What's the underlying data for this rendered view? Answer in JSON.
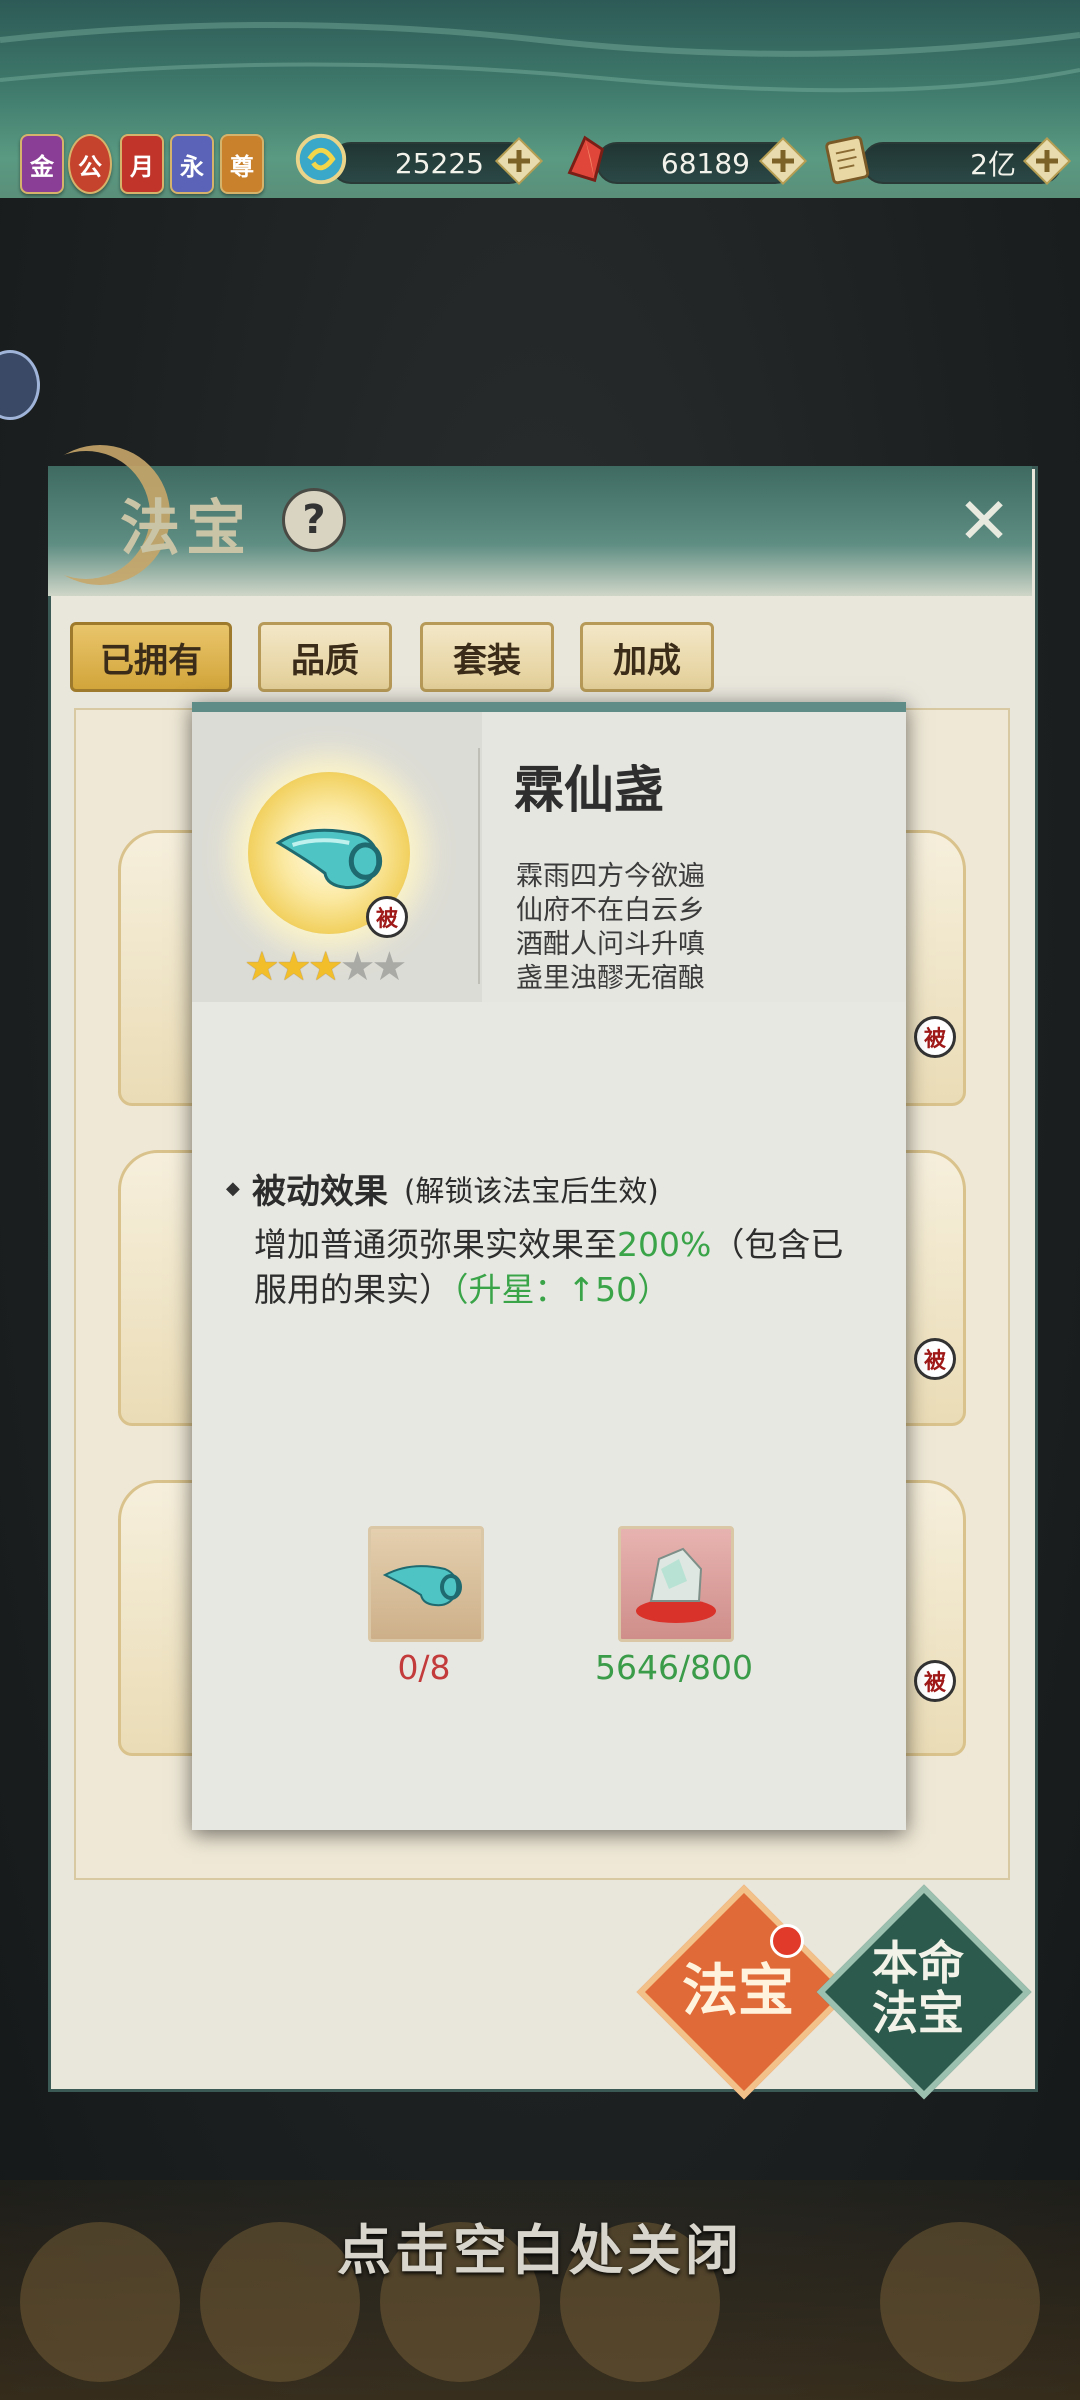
{
  "top_bar": {
    "badges": [
      "金",
      "公",
      "月",
      "永",
      "尊"
    ],
    "resources": [
      {
        "icon": "jade-swirl-icon",
        "value": "25225"
      },
      {
        "icon": "red-crystal-icon",
        "value": "68189"
      },
      {
        "icon": "scroll-icon",
        "value": "2亿"
      }
    ]
  },
  "panel": {
    "title": "法宝",
    "tabs": [
      "已拥有",
      "品质",
      "套装",
      "加成"
    ],
    "side_buttons": {
      "fabao": "法宝",
      "benming_line1": "本命",
      "benming_line2": "法宝"
    }
  },
  "dialog": {
    "item_name": "霖仙盏",
    "poem": [
      "霖雨四方今欲遍",
      "仙府不在白云乡",
      "酒酣人问斗升嗔",
      "盏里浊醪无宿酿"
    ],
    "passive_badge": "被",
    "stars_filled": 3,
    "stars_total": 5,
    "effect_title": "被动效果",
    "effect_condition": "(解锁该法宝后生效)",
    "effect_desc_1": "增加普通须弥果实效果至",
    "effect_value": "200%",
    "effect_desc_2": "（包含已服用的果实）",
    "effect_upgrade": "（升星：↑50）",
    "materials": [
      {
        "icon": "jade-cup-icon",
        "count": "0/8"
      },
      {
        "icon": "spirit-stone-icon",
        "count": "5646/800"
      }
    ]
  },
  "close_hint": "点击空白处关闭",
  "colors": {
    "accent_green": "#3aa449",
    "warn_red": "#c33b3b",
    "panel_teal": "#5f8c86"
  }
}
